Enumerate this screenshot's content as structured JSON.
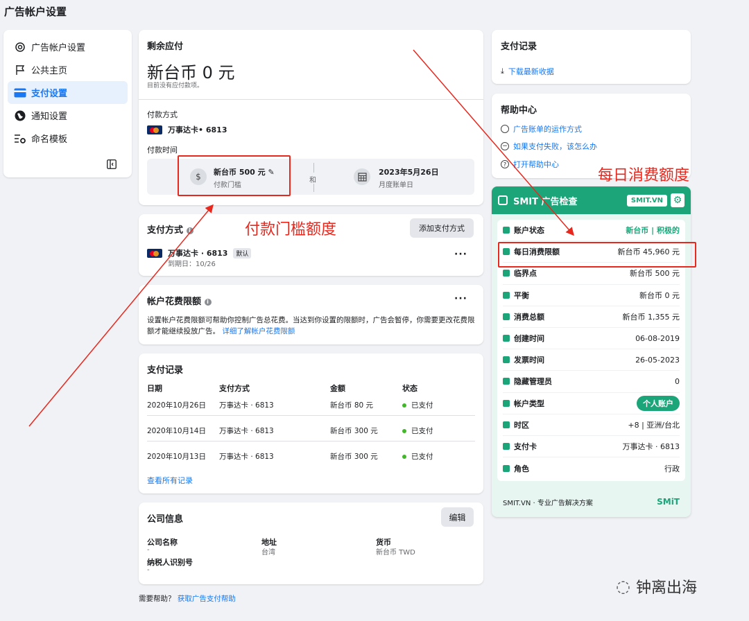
{
  "page_title": "广告帐户设置",
  "sidebar": {
    "items": [
      {
        "label": "广告帐户设置"
      },
      {
        "label": "公共主页"
      },
      {
        "label": "支付设置"
      },
      {
        "label": "通知设置"
      },
      {
        "label": "命名模板"
      }
    ]
  },
  "balance": {
    "title": "剩余应付",
    "amount": "新台币 0 元",
    "note": "目前没有应付款项。",
    "method_label": "付款方式",
    "card": "万事达卡• 6813",
    "timing_label": "付款时间",
    "threshold_amount": "新台币 500 元",
    "threshold_label": "付款门槛",
    "and": "和",
    "bill_date": "2023年5月26日",
    "bill_label": "月度账单日"
  },
  "payment_methods": {
    "title": "支付方式",
    "add_button": "添加支付方式",
    "card": "万事达卡 · 6813",
    "default_badge": "默认",
    "expiry": "到期日：10/26"
  },
  "spending_limit": {
    "title": "帐户花费限额",
    "desc": "设置帐户花费限额可帮助你控制广告总花费。当达到你设置的限额时，广告会暂停，你需要更改花费限额才能继续投放广告。",
    "link": "详细了解帐户花费限额"
  },
  "history": {
    "title": "支付记录",
    "headers": [
      "日期",
      "支付方式",
      "金额",
      "状态"
    ],
    "rows": [
      [
        "2020年10月26日",
        "万事达卡 · 6813",
        "新台币 80 元",
        "已支付"
      ],
      [
        "2020年10月14日",
        "万事达卡 · 6813",
        "新台币 300 元",
        "已支付"
      ],
      [
        "2020年10月13日",
        "万事达卡 · 6813",
        "新台币 300 元",
        "已支付"
      ]
    ],
    "view_all": "查看所有记录"
  },
  "company": {
    "title": "公司信息",
    "edit_button": "编辑",
    "name_label": "公司名称",
    "name_value": "-",
    "address_label": "地址",
    "address_value": "台湾",
    "currency_label": "货币",
    "currency_value": "新台币 TWD",
    "tax_label": "纳税人识别号",
    "tax_value": "-"
  },
  "help_footer": {
    "text": "需要帮助？",
    "link": "获取广告支付帮助"
  },
  "receipts": {
    "title": "支付记录",
    "link": "下载最新收据"
  },
  "help_center": {
    "title": "帮助中心",
    "links": [
      "广告账单的运作方式",
      "如果支付失败，该怎么办",
      "打开帮助中心"
    ]
  },
  "smit": {
    "title": "SMIT 广告检查",
    "badge": "SMIT.VN",
    "rows": [
      {
        "label": "账户状态",
        "value": "新台币 | 积极的"
      },
      {
        "label": "每日消费限额",
        "value": "新台币 45,960 元"
      },
      {
        "label": "临界点",
        "value": "新台币 500 元"
      },
      {
        "label": "平衡",
        "value": "新台币 0 元"
      },
      {
        "label": "消费总额",
        "value": "新台币 1,355 元"
      },
      {
        "label": "创建时间",
        "value": "06-08-2019"
      },
      {
        "label": "发票时间",
        "value": "26-05-2023"
      },
      {
        "label": "隐藏管理员",
        "value": "0"
      },
      {
        "label": "帐户类型",
        "value": "个人账户"
      },
      {
        "label": "时区",
        "value": "+8 | 亚洲/台北"
      },
      {
        "label": "支付卡",
        "value": "万事达卡 · 6813"
      },
      {
        "label": "角色",
        "value": "行政"
      }
    ],
    "footer": "SMIT.VN · 专业广告解决方案",
    "footer_logo": "SMiT"
  },
  "annotations": {
    "threshold": "付款门槛额度",
    "daily": "每日消费额度"
  },
  "watermark": "钟离出海",
  "colors": {
    "accent": "#1877f2",
    "smit_green": "#1da57a",
    "annotation": "#e8271d"
  }
}
